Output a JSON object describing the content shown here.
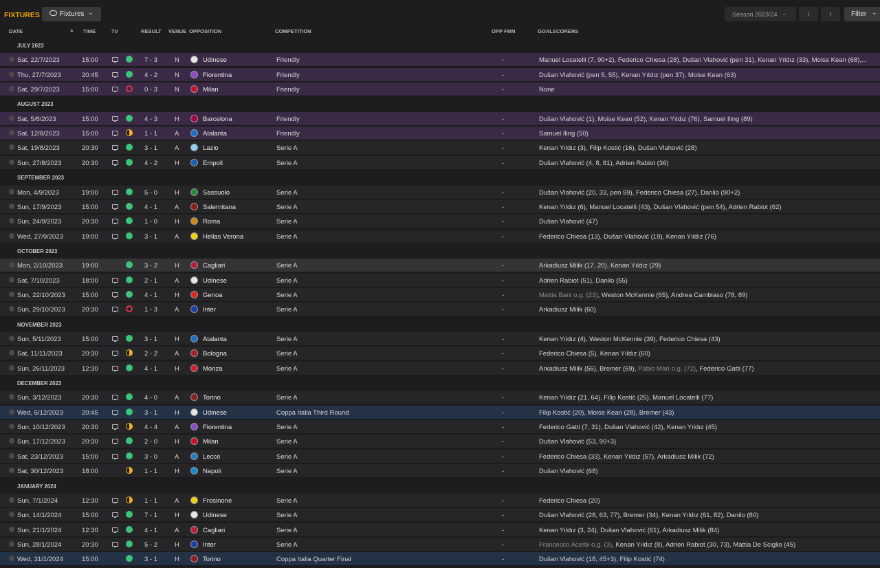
{
  "topbar": {
    "title": "FIXTURES",
    "view_label": "Fixtures",
    "season_label": "Season 2023/24",
    "filter_label": "Filter",
    "prev_icon": "chevron-left-icon",
    "next_icon": "chevron-right-icon"
  },
  "columns": {
    "date": "DATE",
    "time": "TIME",
    "tv": "TV",
    "result": "RESULT",
    "venue": "VENUE",
    "opposition": "OPPOSITION",
    "competition": "COMPETITION",
    "opp_fmn": "OPP FMN",
    "goalscorers": "GOALSCORERS"
  },
  "colors": {
    "title": "#f0a300",
    "win": "#3cc47a",
    "loss": "#e0314a",
    "draw": "#f0b020",
    "friendly_row": "#3a2a45",
    "cup_row": "#233345"
  },
  "months": [
    {
      "label": "JULY 2023",
      "fixtures": [
        {
          "date": "Sat, 22/7/2023",
          "time": "15:00",
          "tv": true,
          "result": "W",
          "score": "7 - 3",
          "venue": "N",
          "opp": "Udinese",
          "crest": "#e6e6e6",
          "comp": "Friendly",
          "fmn": "-",
          "style": "friendly",
          "scorers": [
            {
              "t": "Manuel Locatelli (7, 90+2), Federico Chiesa (28), Dušan Vlahović (pen 31), Kenan Yıldız (33), Moise Kean (68),..."
            }
          ]
        },
        {
          "date": "Thu, 27/7/2023",
          "time": "20:45",
          "tv": true,
          "result": "W",
          "score": "4 - 2",
          "venue": "N",
          "opp": "Fiorentina",
          "crest": "#8a4bc6",
          "comp": "Friendly",
          "fmn": "-",
          "style": "friendly",
          "scorers": [
            {
              "t": "Dušan Vlahović (pen 5, 55), Kenan Yıldız (pen 37), Moise Kean (63)"
            }
          ]
        },
        {
          "date": "Sat, 29/7/2023",
          "time": "15:00",
          "tv": true,
          "result": "L",
          "score": "0 - 3",
          "venue": "N",
          "opp": "Milan",
          "crest": "#c8102e",
          "comp": "Friendly",
          "fmn": "-",
          "style": "friendly",
          "scorers": [
            {
              "t": "None"
            }
          ]
        }
      ]
    },
    {
      "label": "AUGUST 2023",
      "fixtures": [
        {
          "date": "Sat, 5/8/2023",
          "time": "15:00",
          "tv": true,
          "result": "W",
          "score": "4 - 3",
          "venue": "H",
          "opp": "Barcelona",
          "crest": "#a50044",
          "comp": "Friendly",
          "fmn": "-",
          "style": "friendly",
          "scorers": [
            {
              "t": "Dušan Vlahović (1), Moise Kean (52), Kenan Yıldız (76), Samuel Iling (89)"
            }
          ]
        },
        {
          "date": "Sat, 12/8/2023",
          "time": "15:00",
          "tv": true,
          "result": "D",
          "score": "1 - 1",
          "venue": "A",
          "opp": "Atalanta",
          "crest": "#1e6fc8",
          "comp": "Friendly",
          "fmn": "-",
          "style": "friendly",
          "scorers": [
            {
              "t": "Samuel Iling (50)"
            }
          ]
        },
        {
          "date": "Sat, 19/8/2023",
          "time": "20:30",
          "tv": true,
          "result": "W",
          "score": "3 - 1",
          "venue": "A",
          "opp": "Lazio",
          "crest": "#8fd0f0",
          "comp": "Serie A",
          "fmn": "-",
          "style": "",
          "scorers": [
            {
              "t": "Kenan Yıldız (3), Filip Kostić (16), Dušan Vlahović (28)"
            }
          ]
        },
        {
          "date": "Sun, 27/8/2023",
          "time": "20:30",
          "tv": true,
          "result": "W",
          "score": "4 - 2",
          "venue": "H",
          "opp": "Empoli",
          "crest": "#1c5fb5",
          "comp": "Serie A",
          "fmn": "-",
          "style": "",
          "scorers": [
            {
              "t": "Dušan Vlahović (4, 8, 81), Adrien Rabiot (36)"
            }
          ]
        }
      ]
    },
    {
      "label": "SEPTEMBER 2023",
      "fixtures": [
        {
          "date": "Mon, 4/9/2023",
          "time": "19:00",
          "tv": true,
          "result": "W",
          "score": "5 - 0",
          "venue": "H",
          "opp": "Sassuolo",
          "crest": "#2a8a3a",
          "comp": "Serie A",
          "fmn": "-",
          "style": "",
          "scorers": [
            {
              "t": "Dušan Vlahović (20, 33, pen 59), Federico Chiesa (27), Danilo (90+2)"
            }
          ]
        },
        {
          "date": "Sun, 17/9/2023",
          "time": "15:00",
          "tv": true,
          "result": "W",
          "score": "4 - 1",
          "venue": "A",
          "opp": "Salernitana",
          "crest": "#8b1a1a",
          "comp": "Serie A",
          "fmn": "-",
          "style": "",
          "scorers": [
            {
              "t": "Kenan Yıldız (6), Manuel Locatelli (43), Dušan Vlahović (pen 54), Adrien Rabiot (62)"
            }
          ]
        },
        {
          "date": "Sun, 24/9/2023",
          "time": "20:30",
          "tv": true,
          "result": "W",
          "score": "1 - 0",
          "venue": "H",
          "opp": "Roma",
          "crest": "#c88a1a",
          "comp": "Serie A",
          "fmn": "-",
          "style": "",
          "scorers": [
            {
              "t": "Dušan Vlahović (47)"
            }
          ]
        },
        {
          "date": "Wed, 27/9/2023",
          "time": "19:00",
          "tv": true,
          "result": "W",
          "score": "3 - 1",
          "venue": "A",
          "opp": "Hellas Verona",
          "crest": "#f2d20a",
          "comp": "Serie A",
          "fmn": "-",
          "style": "",
          "scorers": [
            {
              "t": "Federico Chiesa (13), Dušan Vlahović (19), Kenan Yıldız (76)"
            }
          ]
        }
      ]
    },
    {
      "label": "OCTOBER 2023",
      "fixtures": [
        {
          "date": "Mon, 2/10/2023",
          "time": "19:00",
          "tv": false,
          "result": "W",
          "score": "3 - 2",
          "venue": "H",
          "opp": "Cagliari",
          "crest": "#b81d3a",
          "comp": "Serie A",
          "fmn": "-",
          "style": "highlight",
          "scorers": [
            {
              "t": "Arkadiusz Milik (17, 20), Kenan Yıldız (29)"
            }
          ]
        },
        {
          "date": "Sat, 7/10/2023",
          "time": "18:00",
          "tv": true,
          "result": "W",
          "score": "2 - 1",
          "venue": "A",
          "opp": "Udinese",
          "crest": "#e6e6e6",
          "comp": "Serie A",
          "fmn": "-",
          "style": "",
          "scorers": [
            {
              "t": "Adrien Rabiot (51), Danilo (55)"
            }
          ]
        },
        {
          "date": "Sun, 22/10/2023",
          "time": "15:00",
          "tv": true,
          "result": "W",
          "score": "4 - 1",
          "venue": "H",
          "opp": "Genoa",
          "crest": "#d8281e",
          "comp": "Serie A",
          "fmn": "-",
          "style": "",
          "scorers": [
            {
              "t": "Mattia Bani o.g. (23)",
              "og": true
            },
            {
              "t": ", Weston McKennie (65), Andrea Cambiaso (78, 89)"
            }
          ]
        },
        {
          "date": "Sun, 29/10/2023",
          "time": "20:30",
          "tv": true,
          "result": "L",
          "score": "1 - 3",
          "venue": "A",
          "opp": "Inter",
          "crest": "#1a3fa8",
          "comp": "Serie A",
          "fmn": "-",
          "style": "",
          "scorers": [
            {
              "t": "Arkadiusz Milik (60)"
            }
          ]
        }
      ]
    },
    {
      "label": "NOVEMBER 2023",
      "fixtures": [
        {
          "date": "Sun, 5/11/2023",
          "time": "15:00",
          "tv": true,
          "result": "W",
          "score": "3 - 1",
          "venue": "H",
          "opp": "Atalanta",
          "crest": "#1e6fc8",
          "comp": "Serie A",
          "fmn": "-",
          "style": "",
          "scorers": [
            {
              "t": "Kenan Yıldız (4), Weston McKennie (39), Federico Chiesa (43)"
            }
          ]
        },
        {
          "date": "Sat, 11/11/2023",
          "time": "20:30",
          "tv": true,
          "result": "D",
          "score": "2 - 2",
          "venue": "A",
          "opp": "Bologna",
          "crest": "#a3202a",
          "comp": "Serie A",
          "fmn": "-",
          "style": "",
          "scorers": [
            {
              "t": "Federico Chiesa (5), Kenan Yıldız (60)"
            }
          ]
        },
        {
          "date": "Sun, 26/11/2023",
          "time": "12:30",
          "tv": true,
          "result": "W",
          "score": "4 - 1",
          "venue": "H",
          "opp": "Monza",
          "crest": "#d2202e",
          "comp": "Serie A",
          "fmn": "-",
          "style": "",
          "scorers": [
            {
              "t": "Arkadiusz Milik (56), Bremer (69), "
            },
            {
              "t": "Pablo Marí o.g. (72)",
              "og": true
            },
            {
              "t": ", Federico Gatti (77)"
            }
          ]
        }
      ]
    },
    {
      "label": "DECEMBER 2023",
      "fixtures": [
        {
          "date": "Sun, 3/12/2023",
          "time": "20:30",
          "tv": true,
          "result": "W",
          "score": "4 - 0",
          "venue": "A",
          "opp": "Torino",
          "crest": "#8a2020",
          "comp": "Serie A",
          "fmn": "-",
          "style": "",
          "scorers": [
            {
              "t": "Kenan Yıldız (21, 64), Filip Kostić (25), Manuel Locatelli (77)"
            }
          ]
        },
        {
          "date": "Wed, 6/12/2023",
          "time": "20:45",
          "tv": true,
          "result": "W",
          "score": "3 - 1",
          "venue": "H",
          "opp": "Udinese",
          "crest": "#e6e6e6",
          "comp": "Coppa Italia Third Round",
          "fmn": "-",
          "style": "cup",
          "scorers": [
            {
              "t": "Filip Kostić (20), Moise Kean (28), Bremer (43)"
            }
          ]
        },
        {
          "date": "Sun, 10/12/2023",
          "time": "20:30",
          "tv": true,
          "result": "D",
          "score": "4 - 4",
          "venue": "A",
          "opp": "Fiorentina",
          "crest": "#8a4bc6",
          "comp": "Serie A",
          "fmn": "-",
          "style": "",
          "scorers": [
            {
              "t": "Federico Gatti (7, 31), Dušan Vlahović (42), Kenan Yıldız (45)"
            }
          ]
        },
        {
          "date": "Sun, 17/12/2023",
          "time": "20:30",
          "tv": true,
          "result": "W",
          "score": "2 - 0",
          "venue": "H",
          "opp": "Milan",
          "crest": "#c8102e",
          "comp": "Serie A",
          "fmn": "-",
          "style": "",
          "scorers": [
            {
              "t": "Dušan Vlahović (53, 90+3)"
            }
          ]
        },
        {
          "date": "Sat, 23/12/2023",
          "time": "15:00",
          "tv": true,
          "result": "W",
          "score": "3 - 0",
          "venue": "A",
          "opp": "Lecce",
          "crest": "#2a7ac0",
          "comp": "Serie A",
          "fmn": "-",
          "style": "",
          "scorers": [
            {
              "t": "Federico Chiesa (33), Kenan Yıldız (57), Arkadiusz Milik (72)"
            }
          ]
        },
        {
          "date": "Sat, 30/12/2023",
          "time": "18:00",
          "tv": false,
          "result": "D",
          "score": "1 - 1",
          "venue": "H",
          "opp": "Napoli",
          "crest": "#1a8ad0",
          "comp": "Serie A",
          "fmn": "-",
          "style": "",
          "scorers": [
            {
              "t": "Dušan Vlahović (68)"
            }
          ]
        }
      ]
    },
    {
      "label": "JANUARY 2024",
      "fixtures": [
        {
          "date": "Sun, 7/1/2024",
          "time": "12:30",
          "tv": true,
          "result": "D",
          "score": "1 - 1",
          "venue": "A",
          "opp": "Frosinone",
          "crest": "#f2d20a",
          "comp": "Serie A",
          "fmn": "-",
          "style": "",
          "scorers": [
            {
              "t": "Federico Chiesa (20)"
            }
          ]
        },
        {
          "date": "Sun, 14/1/2024",
          "time": "15:00",
          "tv": true,
          "result": "W",
          "score": "7 - 1",
          "venue": "H",
          "opp": "Udinese",
          "crest": "#e6e6e6",
          "comp": "Serie A",
          "fmn": "-",
          "style": "",
          "scorers": [
            {
              "t": "Dušan Vlahović (28, 63, 77), Bremer (34), Kenan Yıldız (61, 82), Danilo (80)"
            }
          ]
        },
        {
          "date": "Sun, 21/1/2024",
          "time": "12:30",
          "tv": true,
          "result": "W",
          "score": "4 - 1",
          "venue": "A",
          "opp": "Cagliari",
          "crest": "#b81d3a",
          "comp": "Serie A",
          "fmn": "-",
          "style": "",
          "scorers": [
            {
              "t": "Kenan Yıldız (3, 24), Dušan Vlahović (61), Arkadiusz Milik (84)"
            }
          ]
        },
        {
          "date": "Sun, 28/1/2024",
          "time": "20:30",
          "tv": true,
          "result": "W",
          "score": "5 - 2",
          "venue": "H",
          "opp": "Inter",
          "crest": "#1a3fa8",
          "comp": "Serie A",
          "fmn": "-",
          "style": "",
          "scorers": [
            {
              "t": "Francesco Acerbi o.g. (3)",
              "og": true
            },
            {
              "t": ", Kenan Yıldız (8), Adrien Rabiot (30, 73), Mattia De Sciglio (45)"
            }
          ]
        },
        {
          "date": "Wed, 31/1/2024",
          "time": "15:00",
          "tv": false,
          "result": "W",
          "score": "3 - 1",
          "venue": "H",
          "opp": "Torino",
          "crest": "#8a2020",
          "comp": "Coppa Italia Quarter Final",
          "fmn": "-",
          "style": "cup",
          "scorers": [
            {
              "t": "Dušan Vlahović (18, 45+3), Filip Kostić (74)"
            }
          ]
        }
      ]
    }
  ]
}
